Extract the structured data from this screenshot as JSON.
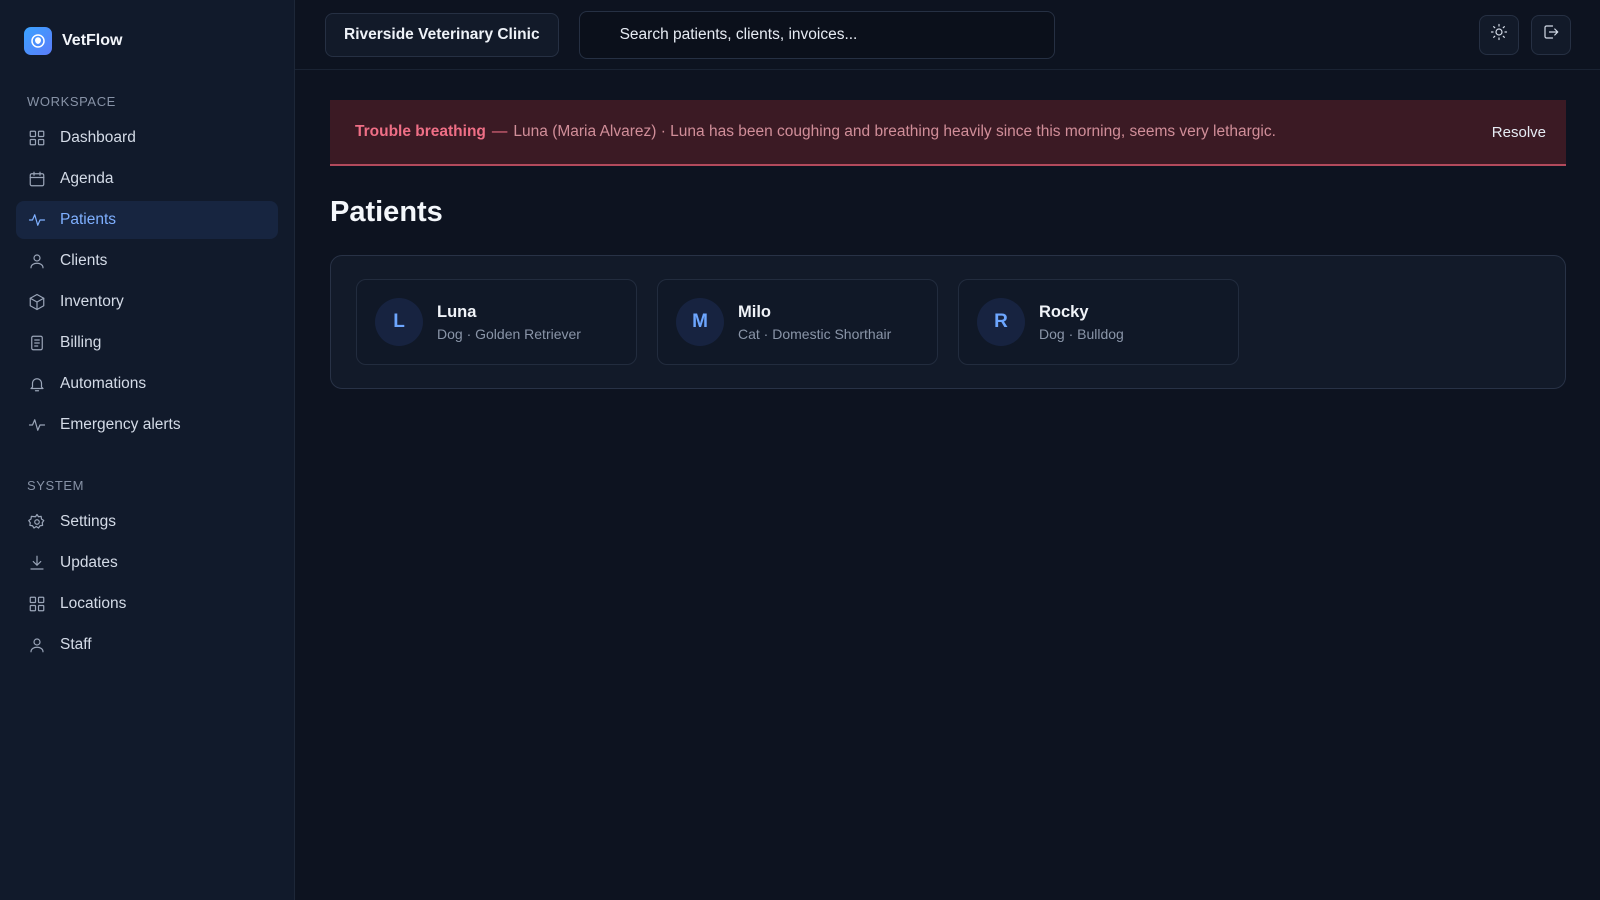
{
  "brand": {
    "name": "VetFlow"
  },
  "sidebar": {
    "workspace_label": "WORKSPACE",
    "workspace_items": [
      {
        "label": "Dashboard",
        "icon": "grid-icon"
      },
      {
        "label": "Agenda",
        "icon": "calendar-icon"
      },
      {
        "label": "Patients",
        "icon": "activity-icon",
        "active": true
      },
      {
        "label": "Clients",
        "icon": "user-icon"
      },
      {
        "label": "Inventory",
        "icon": "box-icon"
      },
      {
        "label": "Billing",
        "icon": "document-icon"
      },
      {
        "label": "Automations",
        "icon": "bell-icon"
      },
      {
        "label": "Emergency alerts",
        "icon": "activity-icon"
      }
    ],
    "system_label": "SYSTEM",
    "system_items": [
      {
        "label": "Settings",
        "icon": "gear-icon"
      },
      {
        "label": "Updates",
        "icon": "download-icon"
      },
      {
        "label": "Locations",
        "icon": "grid-icon"
      },
      {
        "label": "Staff",
        "icon": "user-icon"
      }
    ]
  },
  "topbar": {
    "clinic": "Riverside Veterinary Clinic",
    "search_placeholder": "Search patients, clients, invoices...",
    "theme_icon": "sun-icon",
    "logout_icon": "logout-icon"
  },
  "alert": {
    "title": "Trouble breathing",
    "separator": "—",
    "message": "Luna (Maria Alvarez) · Luna has been coughing and breathing heavily since this morning, seems very lethargic.",
    "resolve_label": "Resolve",
    "color": "#ef6f86"
  },
  "page": {
    "title": "Patients"
  },
  "patients": [
    {
      "initial": "L",
      "name": "Luna",
      "meta": "Dog · Golden Retriever"
    },
    {
      "initial": "M",
      "name": "Milo",
      "meta": "Cat · Domestic Shorthair"
    },
    {
      "initial": "R",
      "name": "Rocky",
      "meta": "Dog · Bulldog"
    }
  ],
  "colors": {
    "accent": "#7fb0ff",
    "background": "#0d1320",
    "sidebar": "#111a2b"
  }
}
